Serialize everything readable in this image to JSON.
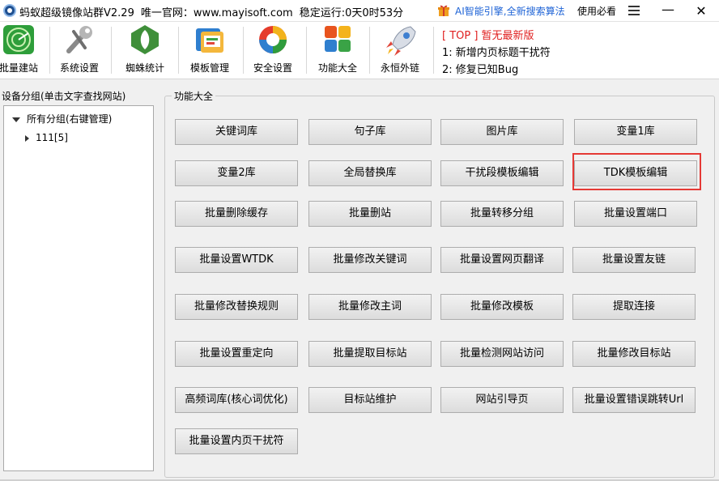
{
  "window": {
    "title_app": "蚂蚁超级镜像站群V2.29",
    "title_site": "唯一官网：www.mayisoft.com",
    "title_uptime": "稳定运行:0天0时53分",
    "ai_text": "AI智能引擎,全新搜索算法",
    "help_link": "使用必看",
    "minimize": "—",
    "close": "✕"
  },
  "toolbar": {
    "items": [
      {
        "label": "批量建站",
        "icon": "radar-icon"
      },
      {
        "label": "系统设置",
        "icon": "wrench-icon"
      },
      {
        "label": "蜘蛛统计",
        "icon": "spider-icon"
      },
      {
        "label": "模板管理",
        "icon": "template-icon"
      },
      {
        "label": "安全设置",
        "icon": "shield-icon"
      },
      {
        "label": "功能大全",
        "icon": "apps-icon"
      },
      {
        "label": "永恒外链",
        "icon": "rocket-icon"
      }
    ]
  },
  "news": {
    "top": "[ TOP ] 暂无最新版",
    "lines": [
      "1:  新增内页标题干扰符",
      "2:  修复已知Bug"
    ]
  },
  "left_panel": {
    "title": "设备分组(单击文字查找网站)",
    "tree": {
      "root": "所有分组(右键管理)",
      "child": "111[5]"
    }
  },
  "right_panel": {
    "title": "功能大全",
    "buttons": [
      "关键词库",
      "句子库",
      "图片库",
      "变量1库",
      "变量2库",
      "全局替换库",
      "干扰段模板编辑",
      "TDK模板编辑",
      "批量删除缓存",
      "批量删站",
      "批量转移分组",
      "批量设置端口",
      "批量设置WTDK",
      "批量修改关键词",
      "批量设置网页翻译",
      "批量设置友链",
      "批量修改替换规则",
      "批量修改主词",
      "批量修改模板",
      "提取连接",
      "批量设置重定向",
      "批量提取目标站",
      "批量检测网站访问",
      "批量修改目标站",
      "高频词库(核心词优化)",
      "目标站维护",
      "网站引导页",
      "批量设置错误跳转Url",
      "批量设置内页干扰符"
    ]
  },
  "colors": {
    "accent_link": "#1e63d6",
    "news_top": "#e02020",
    "highlight_border": "#e53935"
  }
}
